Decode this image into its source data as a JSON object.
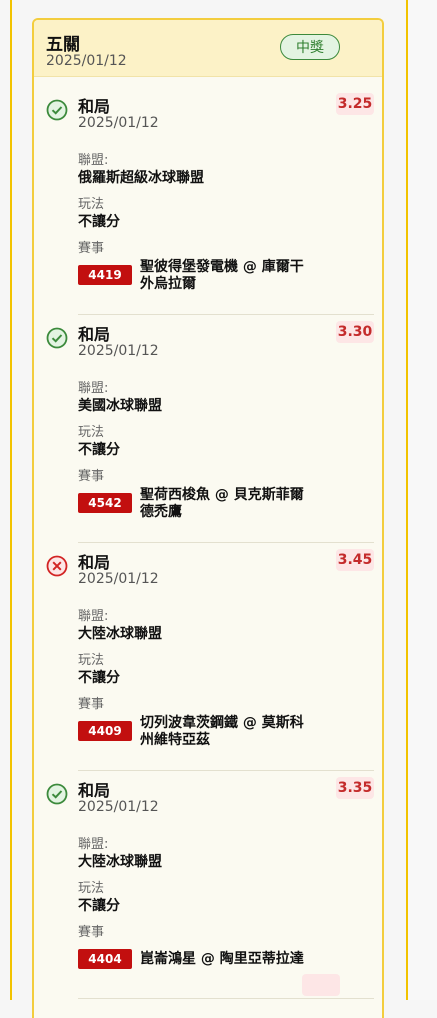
{
  "card": {
    "title": "五關",
    "date": "2025/01/12",
    "badge": "中獎"
  },
  "labels": {
    "league": "聯盟:",
    "play_type": "玩法",
    "match": "賽事"
  },
  "colors": {
    "rail": "#f2c300",
    "win_green": "#3c8a3c",
    "loss_red": "#d22424",
    "odds_red": "#c42b2b",
    "code_bg": "#c20f0f"
  },
  "entries": [
    {
      "status": "win",
      "status_icon": "check-circle-icon",
      "result": "和局",
      "date": "2025/01/12",
      "odds": "3.25",
      "league": "俄羅斯超級冰球聯盟",
      "play": "不讓分",
      "event_code": "4419",
      "event_line1": "聖彼得堡發電機 @ 庫爾干",
      "event_line2": "外烏拉爾"
    },
    {
      "status": "win",
      "status_icon": "check-circle-icon",
      "result": "和局",
      "date": "2025/01/12",
      "odds": "3.30",
      "league": "美國冰球聯盟",
      "play": "不讓分",
      "event_code": "4542",
      "event_line1": "聖荷西梭魚 @ 貝克斯菲爾",
      "event_line2": "德禿鷹"
    },
    {
      "status": "loss",
      "status_icon": "x-circle-icon",
      "result": "和局",
      "date": "2025/01/12",
      "odds": "3.45",
      "league": "大陸冰球聯盟",
      "play": "不讓分",
      "event_code": "4409",
      "event_line1": "切列波韋茨鋼鐵 @ 莫斯科",
      "event_line2": "州維特亞茲"
    },
    {
      "status": "win",
      "status_icon": "check-circle-icon",
      "result": "和局",
      "date": "2025/01/12",
      "odds": "3.35",
      "league": "大陸冰球聯盟",
      "play": "不讓分",
      "event_code": "4404",
      "event_line1": "崑崙鴻星 @ 陶里亞蒂拉達",
      "event_line2": ""
    }
  ]
}
